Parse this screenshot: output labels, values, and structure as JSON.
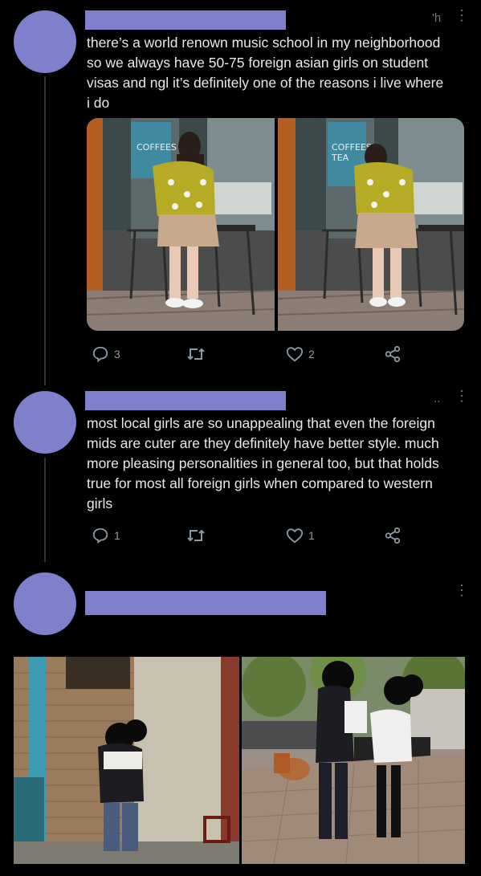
{
  "tweets": [
    {
      "author_redacted": true,
      "time": "'h",
      "more": "⋮",
      "text": "there’s a world renown music school in my neighborhood\nso we always have 50-75 foreign asian girls on student\nvisas and ngl it’s definitely one of the reasons i live where\ni do",
      "photos": [
        "street-photo-1",
        "street-photo-2"
      ],
      "replies": "3",
      "retweets": "",
      "likes": "2"
    },
    {
      "author_redacted": true,
      "time": "..",
      "more": "⋮",
      "text": "most local girls are so unappealing that even the foreign\nmids are cuter are they definitely have better style. much\nmore pleasing personalities in general too, but that holds\ntrue for most all foreign girls when compared to western\ngirls",
      "replies": "1",
      "retweets": "",
      "likes": "1"
    },
    {
      "author_redacted": true,
      "more": "⋮",
      "photos": [
        "alley-photo",
        "plaza-photo"
      ]
    }
  ],
  "signs": {
    "shop_sign_1": "COFFEES",
    "shop_sign_2": "COFFEES\nTEA"
  },
  "colors": {
    "background": "#000000",
    "redaction": "#7f80cc",
    "text": "#e7e9ea",
    "muted": "#8b98a5"
  }
}
